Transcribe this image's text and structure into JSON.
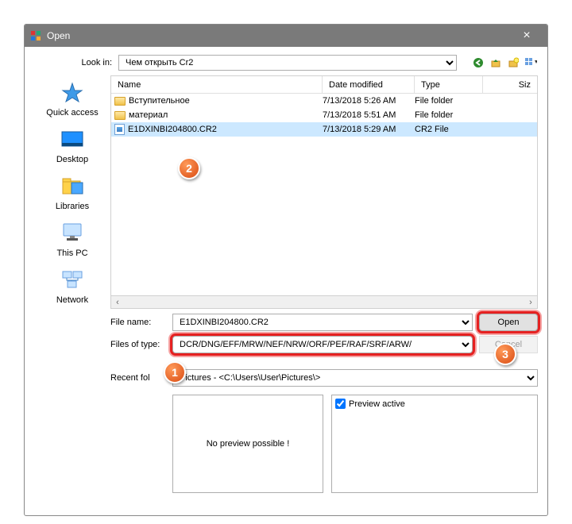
{
  "title": "Open",
  "lookin": {
    "label": "Look in:",
    "value": "Чем открыть Cr2"
  },
  "columns": {
    "name": "Name",
    "date": "Date modified",
    "type": "Type",
    "size": "Siz"
  },
  "files": [
    {
      "name": "Вступительное",
      "date": "7/13/2018 5:26 AM",
      "type": "File folder",
      "kind": "folder"
    },
    {
      "name": "материал",
      "date": "7/13/2018 5:51 AM",
      "type": "File folder",
      "kind": "folder"
    },
    {
      "name": "E1DXINBI204800.CR2",
      "date": "7/13/2018 5:29 AM",
      "type": "CR2 File",
      "kind": "file",
      "selected": true
    }
  ],
  "places": {
    "quick": "Quick access",
    "desktop": "Desktop",
    "libraries": "Libraries",
    "thispc": "This PC",
    "network": "Network"
  },
  "filename": {
    "label": "File name:",
    "value": "E1DXINBI204800.CR2"
  },
  "filetype": {
    "label": "Files of type:",
    "value": "DCR/DNG/EFF/MRW/NEF/NRW/ORF/PEF/RAF/SRF/ARW/"
  },
  "recent": {
    "label": "Recent fol",
    "value": "Pictures  -  <C:\\Users\\User\\Pictures\\>"
  },
  "buttons": {
    "open": "Open",
    "cancel": "Cancel"
  },
  "preview": {
    "checkbox": "Preview active",
    "empty": "No preview possible !"
  },
  "markers": {
    "m1": "1",
    "m2": "2",
    "m3": "3"
  }
}
